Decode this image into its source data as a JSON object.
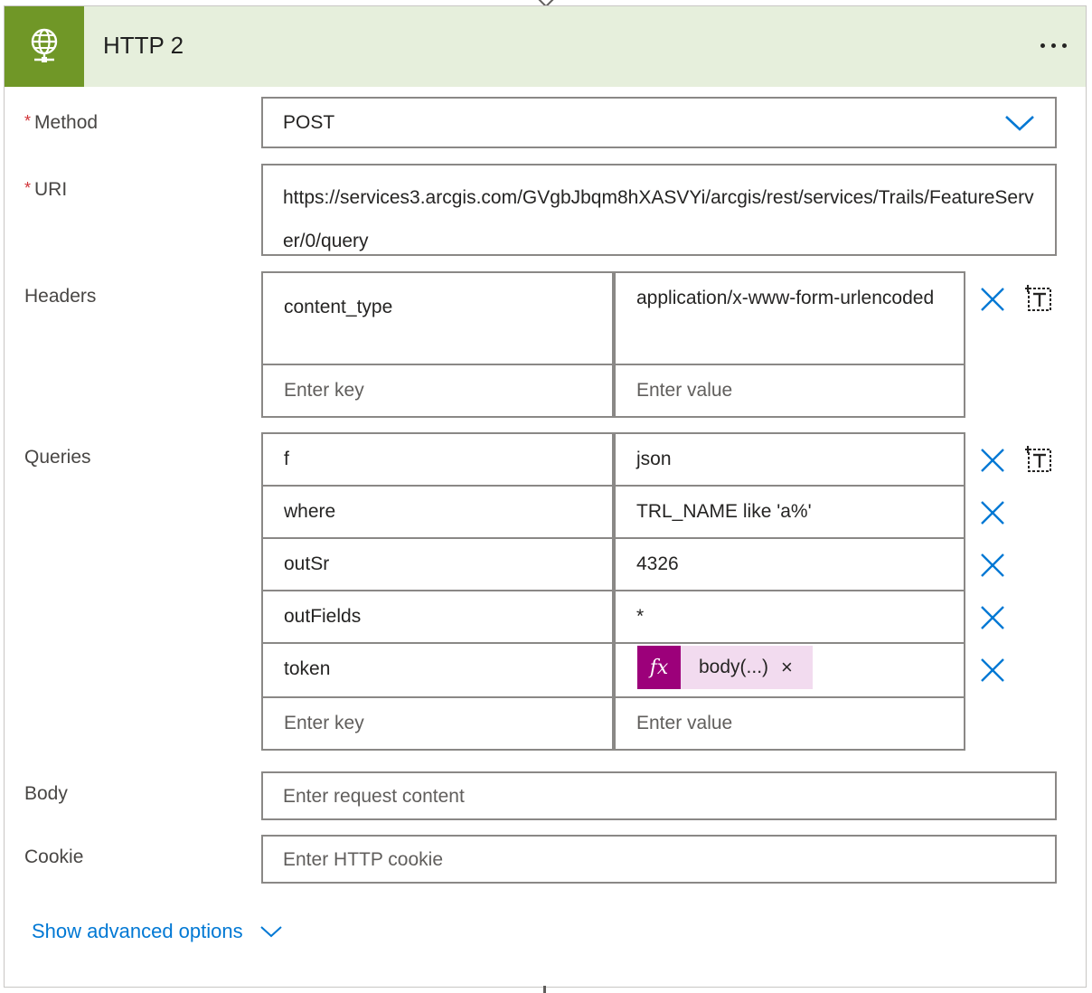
{
  "card": {
    "title": "HTTP 2",
    "icon": "globe-icon",
    "header_color": "#e6efdc",
    "icon_bg_color": "#709727",
    "more_icon": "more-options-icon"
  },
  "method": {
    "label": "Method",
    "required_marker": "*",
    "value": "POST"
  },
  "uri": {
    "label": "URI",
    "required_marker": "*",
    "value": "https://services3.arcgis.com/GVgbJbqm8hXASVYi/arcgis/rest/services/Trails/FeatureServer/0/query"
  },
  "headers": {
    "label": "Headers",
    "rows": [
      {
        "key": "content_type",
        "value": "application/x-www-form-urlencoded"
      }
    ],
    "key_placeholder": "Enter key",
    "value_placeholder": "Enter value"
  },
  "queries": {
    "label": "Queries",
    "rows": [
      {
        "key": "f",
        "value": "json"
      },
      {
        "key": "where",
        "value": "TRL_NAME like 'a%'"
      },
      {
        "key": "outSr",
        "value": "4326"
      },
      {
        "key": "outFields",
        "value": "*"
      },
      {
        "key": "token",
        "expression": {
          "symbol": "fx",
          "label": "body(...)",
          "close": "×"
        }
      }
    ],
    "key_placeholder": "Enter key",
    "value_placeholder": "Enter value"
  },
  "body": {
    "label": "Body",
    "placeholder": "Enter request content"
  },
  "cookie": {
    "label": "Cookie",
    "placeholder": "Enter HTTP cookie"
  },
  "advanced": {
    "label": "Show advanced options"
  },
  "colors": {
    "accent": "#0078d4",
    "required": "#d13438",
    "expression_chip": "#9c007a",
    "expression_chip_bg": "#f2dbef"
  }
}
